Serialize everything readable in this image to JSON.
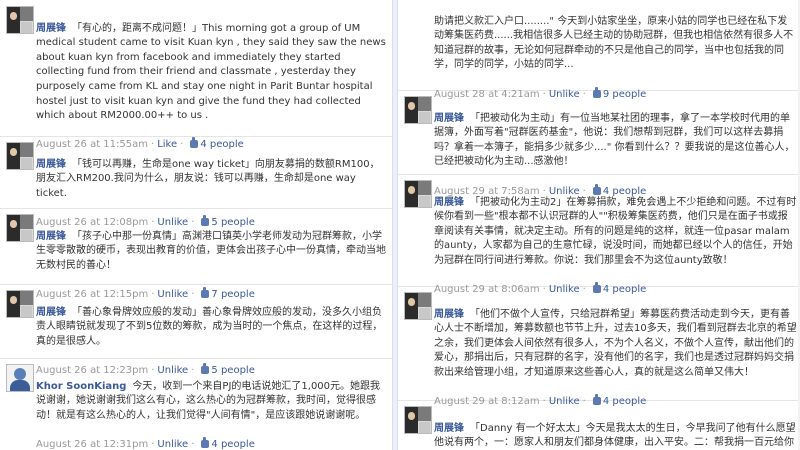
{
  "left_posts": [
    {
      "author": "周展锋",
      "text": "「有心的，距离不成问题！」This morning got a group of UM medical student came to visit Kuan kyn , they said they saw the news about kuan kyn from facebook and immediately they started collecting fund from their friend and classmate , yesterday they purposely came from KL and stay one night in Parit Buntar hospital hostel just to visit kuan kyn and give the fund they had collected which about RM2000.00++ to us .",
      "time": "August 26 at 11:55am",
      "actions": [
        "Like"
      ],
      "likes": "4 people"
    },
    {
      "author": "周展锋",
      "text": "「钱可以再赚，生命是one way ticket」向朋友募捐的数额RM100，朋友汇入RM200.我问为什么，朋友说：钱可以再赚，生命却是one way ticket.",
      "time": "August 26 at 12:08pm",
      "actions": [
        "Unlike"
      ],
      "likes": "5 people"
    },
    {
      "author": "周展锋",
      "text": "「孩子心中那一份真情」高渊港口镇英小学老师发动为冠群筹款，小学生零零散散的硬币，表现出教育的价值，更体会出孩子心中一份真情，牵动当地无数村民的善心！",
      "time": "August 26 at 12:15pm",
      "actions": [
        "Unlike"
      ],
      "likes": "7 people"
    },
    {
      "author": "周展锋",
      "text": "「善心象骨牌效应般的发动」善心象骨牌效应般的发动，没多久小组负责人眼睛锐就发现了不到5位数的筹款，成为当时的一个焦点，在这样的过程，真的是很感人。",
      "time": "August 26 at 12:23pm",
      "actions": [
        "Unlike"
      ],
      "likes": "5 people"
    },
    {
      "author": "Khor SoonKiang",
      "text": "今天，收到一个来自PJ的电话说她汇了1,000元。她跟我说谢谢，她说谢谢我们这么有心，这么热心的为冠群筹款，我时间，觉得很感动！就是有这么热心的人，让我们觉得\"人间有情\"，是应该跟她说谢谢呢。",
      "time": "August 26 at 12:31pm",
      "actions": [
        "Unlike"
      ],
      "likes": "4 people"
    }
  ],
  "right_posts": [
    {
      "author": "",
      "text": "助请把义款汇入户口........\" 今天到小姑家坐坐，原来小姑的同学也已经在私下发动筹集医药费......我相信很多人已经主动的协助冠群，但我也相信依然有很多人不知道冠群的故事，无论如何冠群牵动的不只是他自己的同学，当中也包括我的同学，同学的同学，小姑的同学...",
      "time": "August 28 at 4:21am",
      "actions": [
        "Unlike"
      ],
      "likes": "9 people"
    },
    {
      "author": "周展锋",
      "text": "「把被动化为主动」有一位当地某社团的理事，拿了一本学校时代用的单据簿，外面写着\"冠群医药基金\"，他说：我们想帮到冠群，我们可以这样去募捐吗？拿着一本簿子，能捐多少就多少....\" 你看到什么？？要我说的是这位善心人，已经把被动化为主动...感激他！",
      "time": "August 29 at 7:58am",
      "actions": [
        "Unlike"
      ],
      "likes": "4 people"
    },
    {
      "author": "周展锋",
      "text": "「把被动化为主动2」在筹募捐款，难免会遇上不少拒绝和问题。不过有时候你看到一些\"根本都不认识冠群的人\"\"积极筹集医药费，他们只是在面子书或报章阅读有关事情，就决定主动。所有的问题是纯的这样，就连一位pasar malam的aunty，人家都为自己的生意忙碌，说没时间，而她都已经以个人的信任，开始为冠群在同行间进行筹款。你说：我们那里会不为这位aunty致敬！",
      "time": "August 29 at 8:06am",
      "actions": [
        "Unlike"
      ],
      "likes": "4 people"
    },
    {
      "author": "周展锋",
      "text": "「他们不做个人宣传，只给冠群希望」筹募医药费活动走到今天，更有善心人士不断增加，筹募数额也节节上升，过去10多天，我们看到冠群去北京的希望之余，我们更体会人间依然有很多人，不为个人名义，不做个人宣传，献出他们的爱心，那捐出后，只有冠群的名字，没有他们的名字，我们也是透过冠群妈妈交捐款出来给管理小组，才知道原来这些善心人，真的就是这么简单又伟大！",
      "time": "August 29 at 8:12am",
      "actions": [
        "Unlike"
      ],
      "likes": "4 people"
    },
    {
      "author": "周展锋",
      "text": "「Danny 有一个好太太」今天是我太太的生日，今早我问了他有什么愿望他说有两个，一：愿家人和朋友们都身体健康，出入平安。二：帮我捐一百元给你那篇募款文(马冠群)，愿他能早日康复过",
      "time": "",
      "actions": [],
      "likes": ""
    }
  ],
  "colors": {
    "link": "#3b5998",
    "meta": "#999999",
    "background": "#eceff5"
  },
  "icons": [
    "thumbs-up-icon",
    "avatar"
  ]
}
